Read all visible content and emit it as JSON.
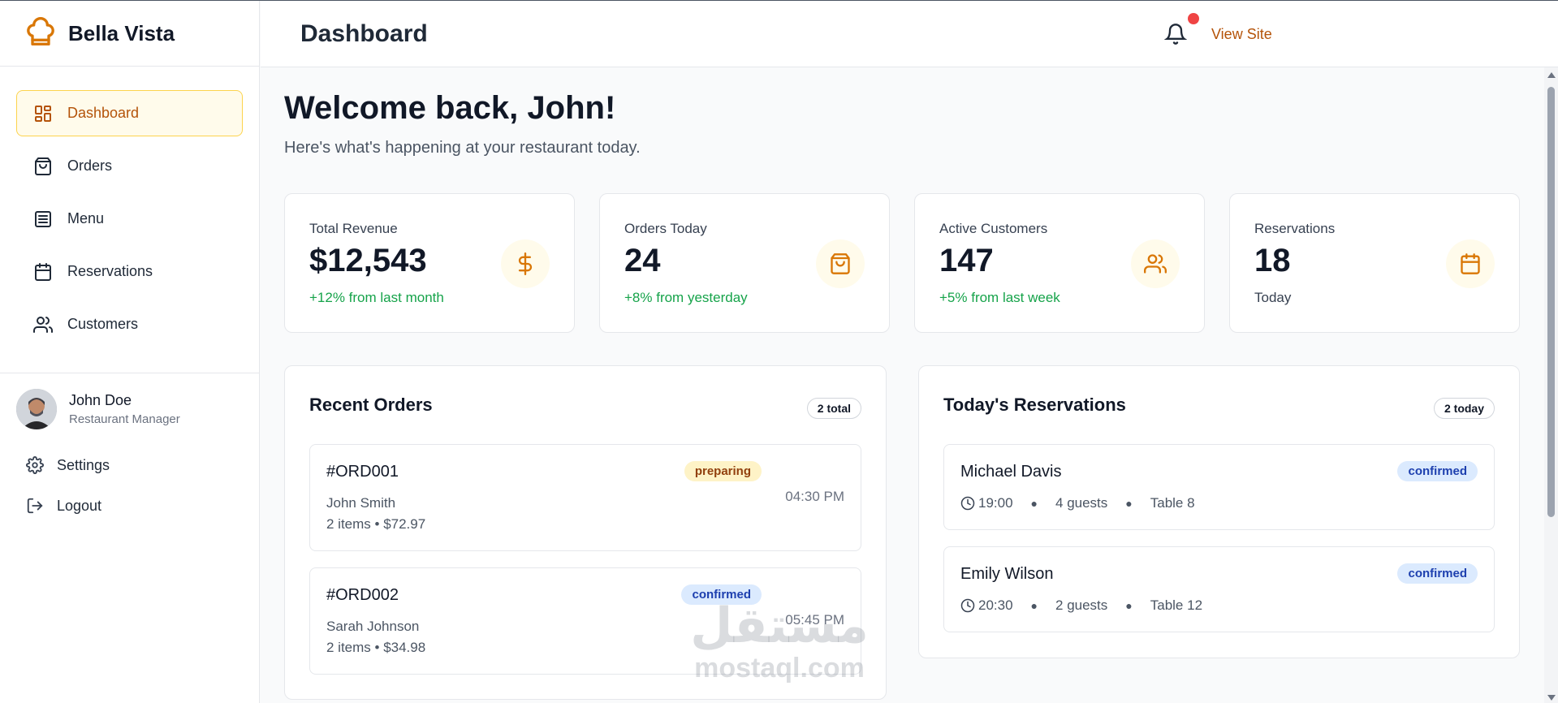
{
  "brand": {
    "name": "Bella Vista",
    "accent": "#d97706"
  },
  "sidebar": {
    "items": [
      {
        "label": "Dashboard",
        "icon": "dashboard-icon",
        "active": true
      },
      {
        "label": "Orders",
        "icon": "shopping-bag-icon",
        "active": false
      },
      {
        "label": "Menu",
        "icon": "menu-list-icon",
        "active": false
      },
      {
        "label": "Reservations",
        "icon": "calendar-icon",
        "active": false
      },
      {
        "label": "Customers",
        "icon": "users-icon",
        "active": false
      }
    ],
    "user": {
      "name": "John Doe",
      "role": "Restaurant Manager"
    },
    "settings_label": "Settings",
    "logout_label": "Logout"
  },
  "header": {
    "title": "Dashboard",
    "view_site_label": "View Site",
    "notification_dot_color": "#ef4444"
  },
  "main": {
    "welcome": "Welcome back, John!",
    "subtitle": "Here's what's happening at your restaurant today.",
    "stats": [
      {
        "label": "Total Revenue",
        "value": "$12,543",
        "change": "+12% from last month",
        "icon": "dollar-icon"
      },
      {
        "label": "Orders Today",
        "value": "24",
        "change": "+8% from yesterday",
        "icon": "shopping-bag-icon"
      },
      {
        "label": "Active Customers",
        "value": "147",
        "change": "+5% from last week",
        "icon": "users-icon"
      },
      {
        "label": "Reservations",
        "value": "18",
        "change": "Today",
        "icon": "calendar-icon"
      }
    ],
    "recent_orders": {
      "title": "Recent Orders",
      "badge": "2 total",
      "orders": [
        {
          "id": "#ORD001",
          "status": "preparing",
          "customer": "John Smith",
          "details": "2 items • $72.97",
          "time": "04:30 PM"
        },
        {
          "id": "#ORD002",
          "status": "confirmed",
          "customer": "Sarah Johnson",
          "details": "2 items • $34.98",
          "time": "05:45 PM"
        }
      ]
    },
    "reservations": {
      "title": "Today's Reservations",
      "badge": "2 today",
      "items": [
        {
          "name": "Michael Davis",
          "status": "confirmed",
          "time": "19:00",
          "guests": "4 guests",
          "table": "Table 8"
        },
        {
          "name": "Emily Wilson",
          "status": "confirmed",
          "time": "20:30",
          "guests": "2 guests",
          "table": "Table 12"
        }
      ]
    }
  },
  "watermark": {
    "arabic": "مستقل",
    "latin": "mostaql.com"
  }
}
